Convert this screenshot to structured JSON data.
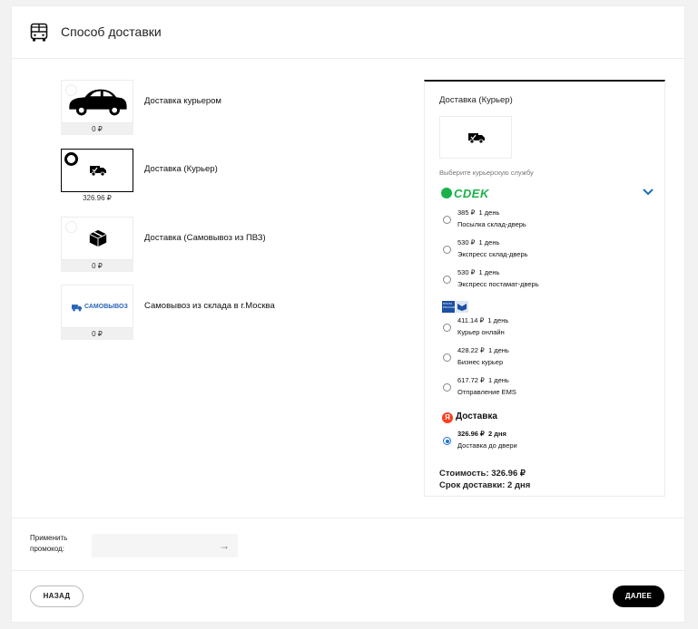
{
  "header": {
    "title": "Способ доставки",
    "icon": "bus-icon"
  },
  "options": [
    {
      "label": "Доставка курьером",
      "price": "0 ₽",
      "icon": "car-icon",
      "selected": false
    },
    {
      "label": "Доставка (Курьер)",
      "price": "326.96 ₽",
      "icon": "delivery-truck-icon",
      "selected": true
    },
    {
      "label": "Доставка (Самовывоз из ПВЗ)",
      "price": "0 ₽",
      "icon": "parcel-box-icon",
      "selected": false
    },
    {
      "label": "Самовывоз из склада в г.Москва",
      "price": "0 ₽",
      "icon": "pickup-icon",
      "logo_text": "САМОВЫВОЗ",
      "selected": false
    }
  ],
  "detail": {
    "title": "Доставка (Курьер)",
    "hint": "Выберите курьерскую службу",
    "cdek": {
      "logo": "СDEK",
      "services": [
        {
          "price": "385 ₽",
          "days": "1 день",
          "name": "Посылка склад-дверь"
        },
        {
          "price": "530 ₽",
          "days": "1 день",
          "name": "Экспресс склад-дверь"
        },
        {
          "price": "530 ₽",
          "days": "1 день",
          "name": "Экспресс постамат-дверь"
        }
      ]
    },
    "pochta": {
      "logo_text": "ПОЧТА РОССИИ",
      "services": [
        {
          "price": "411.14 ₽",
          "days": "1 день",
          "name": "Курьер онлайн"
        },
        {
          "price": "428.22 ₽",
          "days": "1 день",
          "name": "Бизнес курьер"
        },
        {
          "price": "617.72 ₽",
          "days": "1 день",
          "name": "Отправление EMS"
        }
      ]
    },
    "yandex": {
      "logo_letter": "Я",
      "logo": "Доставка",
      "services": [
        {
          "price": "326.96 ₽",
          "days": "2 дня",
          "name": "Доставка до двери",
          "selected": true
        }
      ]
    },
    "cost": "Стоимость: 326.96 ₽",
    "term": "Срок доставки: 2 дня"
  },
  "promo": {
    "label": "Применить промокод:",
    "placeholder": "",
    "arrow": "→"
  },
  "buttons": {
    "back": "НАЗАД",
    "next": "ДАЛЕЕ"
  },
  "colors": {
    "cdek_green": "#1ab248",
    "yandex_red": "#fc3f1d",
    "radio_blue": "#1e73d8",
    "chevron_blue": "#1b6fb3"
  }
}
